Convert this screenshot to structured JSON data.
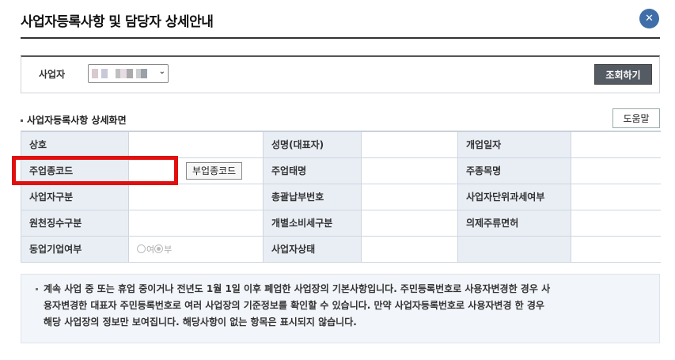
{
  "header": {
    "title": "사업자등록사항 및 담당자 상세안내",
    "close_glyph": "✕"
  },
  "search": {
    "label": "사업자",
    "select_arrow": "⌄",
    "query_button": "조회하기"
  },
  "section": {
    "title": "사업자등록사항 상세화면",
    "help_button": "도움말"
  },
  "detail": {
    "rows": [
      [
        "상호",
        "",
        "성명(대표자)",
        "",
        "개업일자",
        ""
      ],
      [
        "주업종코드",
        "부업종코드",
        "주업태명",
        "",
        "주종목명",
        ""
      ],
      [
        "사업자구분",
        "",
        "총괄납부번호",
        "",
        "사업자단위과세여부",
        ""
      ],
      [
        "원천징수구분",
        "",
        "개별소비세구분",
        "",
        "의제주류면허",
        ""
      ],
      [
        "동업기업여부",
        "",
        "사업자상태",
        "",
        "",
        ""
      ]
    ],
    "radio_yes": "여",
    "radio_no": "부"
  },
  "notice": {
    "line1": "계속 사업 중 또는 휴업 중이거나 전년도 1월 1일 이후 폐업한 사업장의 기본사항입니다. 주민등록번호로 사용자변경한 경우 사",
    "line2": "용자변경한 대표자 주민등록번호로 여러 사업장의 기준정보를 확인할 수 있습니다. 만약 사업자등록번호로 사용자변경 한 경우",
    "line3": "해당 사업장의 정보만 보여집니다. 해당사항이 없는 항목은 표시되지 않습니다."
  },
  "colors": {
    "close_button": "#3f6ea8",
    "query_button": "#555b63",
    "header_cell": "#e9eef5",
    "highlight": "#e01010"
  }
}
